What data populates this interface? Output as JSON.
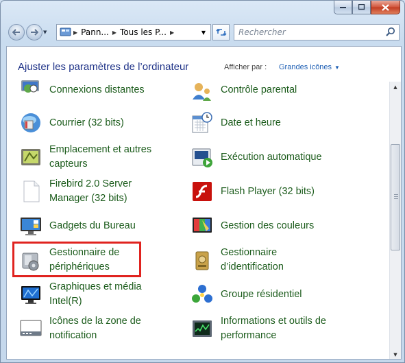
{
  "window": {
    "minimize_label": "minimize",
    "maximize_label": "maximize",
    "close_label": "close"
  },
  "nav": {
    "breadcrumbs": [
      "Pann...",
      "Tous les P..."
    ],
    "search_placeholder": "Rechercher"
  },
  "header": {
    "title": "Ajuster les paramètres de l’ordinateur",
    "view_by_label": "Afficher par :",
    "view_by_value": "Grandes icônes"
  },
  "items": {
    "left": [
      {
        "label": "Connexions distantes",
        "icon": "remote-connection-icon"
      },
      {
        "label": "Courrier (32 bits)",
        "icon": "mail-icon"
      },
      {
        "label": "Emplacement et autres capteurs",
        "icon": "location-sensor-icon"
      },
      {
        "label": "Firebird 2.0 Server Manager (32 bits)",
        "icon": "blank-document-icon"
      },
      {
        "label": "Gadgets du Bureau",
        "icon": "desktop-gadgets-icon"
      },
      {
        "label": "Gestionnaire de périphériques",
        "icon": "device-manager-icon"
      },
      {
        "label": "Graphiques et média Intel(R)",
        "icon": "intel-graphics-icon"
      },
      {
        "label": "Icônes de la zone de notification",
        "icon": "notification-area-icon"
      }
    ],
    "right": [
      {
        "label": "Contrôle parental",
        "icon": "parental-control-icon"
      },
      {
        "label": "Date et heure",
        "icon": "calendar-clock-icon"
      },
      {
        "label": "Exécution automatique",
        "icon": "autoplay-icon"
      },
      {
        "label": "Flash Player (32 bits)",
        "icon": "flash-player-icon"
      },
      {
        "label": "Gestion des couleurs",
        "icon": "color-management-icon"
      },
      {
        "label": "Gestionnaire d’identification",
        "icon": "credential-manager-icon"
      },
      {
        "label": "Groupe résidentiel",
        "icon": "homegroup-icon"
      },
      {
        "label": "Informations et outils de performance",
        "icon": "performance-icon"
      }
    ]
  },
  "colors": {
    "link_green": "#1c5c1c",
    "title_blue": "#1e3287",
    "highlight_red": "#e0231f"
  }
}
